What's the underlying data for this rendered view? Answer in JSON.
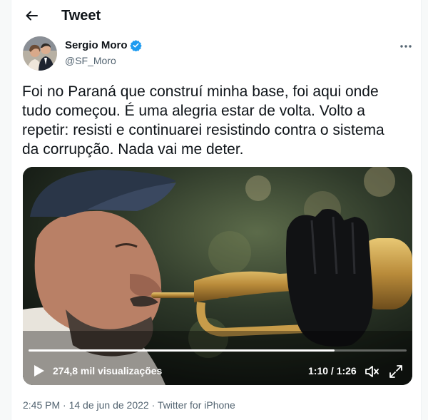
{
  "header": {
    "title": "Tweet",
    "back_icon": "arrow-left-icon"
  },
  "author": {
    "name": "Sergio Moro",
    "handle": "@SF_Moro",
    "verified_color": "#1d9bf0"
  },
  "tweet": {
    "lines": [
      "Foi no Paraná que construí minha base, foi aqui onde",
      "tudo começou. É uma alegria estar de volta. Volto a",
      "repetir: resisti e continuarei resistindo contra o sistema",
      "da corrupção. Nada vai me deter."
    ]
  },
  "video": {
    "views": "274,8 mil visualizações",
    "time": "1:10 / 1:26",
    "progress": 0.81
  },
  "meta": {
    "time": "2:45 PM",
    "sep1": "·",
    "date": "14 de jun de 2022",
    "sep2": "·",
    "source": "Twitter for iPhone"
  },
  "colors": {
    "text": "#0f1419",
    "secondary": "#536471",
    "accent": "#1d9bf0"
  }
}
